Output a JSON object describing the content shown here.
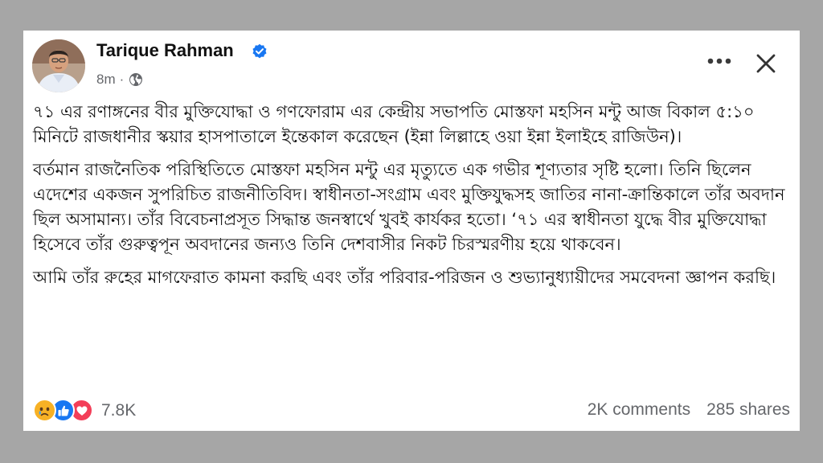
{
  "post": {
    "author": "Tarique Rahman",
    "time": "8m",
    "separator": "·",
    "paragraphs": [
      "৭১ এর রণাঙ্গনের বীর মুক্তিযোদ্ধা ও গণফোরাম এর কেন্দ্রীয় সভাপতি মোস্তফা মহসিন মন্টু আজ বিকাল ৫:১০ মিনিটে রাজধানীর স্কয়ার হাসপাতালে ইন্তেকাল করেছেন (ইন্না লিল্লাহে ওয়া ইন্না ইলাইহে রাজিউন)।",
      "বর্তমান রাজনৈতিক পরিস্থিতিতে মোস্তফা মহসিন মন্টু এর মৃত্যুতে এক গভীর শূণ্যতার সৃষ্টি হলো। তিনি ছিলেন এদেশের একজন সুপরিচিত রাজনীতিবিদ। স্বাধীনতা-সংগ্রাম এবং মুক্তিযুদ্ধসহ জাতির নানা-ক্রান্তিকালে তাঁর অবদান ছিল অসামান্য। তাঁর বিবেচনাপ্রসূত সিদ্ধান্ত জনস্বার্থে খুবই কার্যকর হতো। ‘৭১ এর স্বাধীনতা যুদ্ধে বীর মুক্তিযোদ্ধা হিসেবে তাঁর গুরুত্বপূন অবদানের জন্যও তিনি দেশবাসীর নিকট চিরস্মরণীয় হয়ে থাকবেন।",
      "আমি তাঁর রুহের মাগফেরাত কামনা করছি এবং তাঁর পরিবার-পরিজন ও শুভ্যানুধ্যায়ীদের সমবেদনা জ্ঞাপন করছি।"
    ]
  },
  "engagement": {
    "reaction_icons": [
      "sad-reaction-icon",
      "like-reaction-icon",
      "love-reaction-icon"
    ],
    "reaction_count": "7.8K",
    "comments": "2K comments",
    "shares": "285 shares"
  },
  "colors": {
    "background": "#a6a6a6",
    "card": "#ffffff",
    "verified_badge": "#1877f2",
    "like": "#1877f2",
    "love": "#f33e58",
    "sad": "#f7b125",
    "secondary_text": "#65676b"
  }
}
